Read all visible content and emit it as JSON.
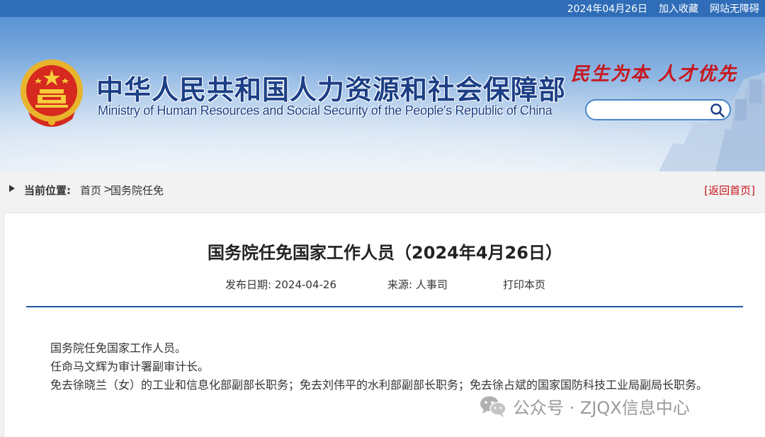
{
  "topbar": {
    "date": "2024年04月26日",
    "add_favorite": "加入收藏",
    "accessibility": "网站无障碍"
  },
  "header": {
    "ministry_cn": "中华人民共和国人力资源和社会保障部",
    "ministry_en": "Ministry of Human Resources and Social Security of the People's Republic of China",
    "slogan": "民生为本 人才优先",
    "search": {
      "placeholder": "",
      "value": ""
    }
  },
  "breadcrumb": {
    "label": "当前位置:",
    "home": "首页",
    "separator": ">",
    "current": "国务院任免",
    "return_home": "[返回首页]"
  },
  "article": {
    "title": "国务院任免国家工作人员（2024年4月26日）",
    "publish_date": "发布日期:  2024-04-26",
    "source": "来源:  人事司",
    "print": "打印本页",
    "paragraphs": [
      "国务院任免国家工作人员。",
      "任命马文辉为审计署副审计长。",
      "免去徐晓兰（女）的工业和信息化部副部长职务；免去刘伟平的水利部副部长职务；免去徐占斌的国家国防科技工业局副局长职务。"
    ]
  },
  "watermark": {
    "text": "公众号 · ZJQX信息中心"
  },
  "colors": {
    "topbar_bg": "#2f6db8",
    "title_blue": "#1c3f86",
    "slogan_red": "#c8161d",
    "rule_blue": "#1e57a3"
  },
  "icons": [
    "national-emblem",
    "search-icon",
    "wechat-icon"
  ]
}
